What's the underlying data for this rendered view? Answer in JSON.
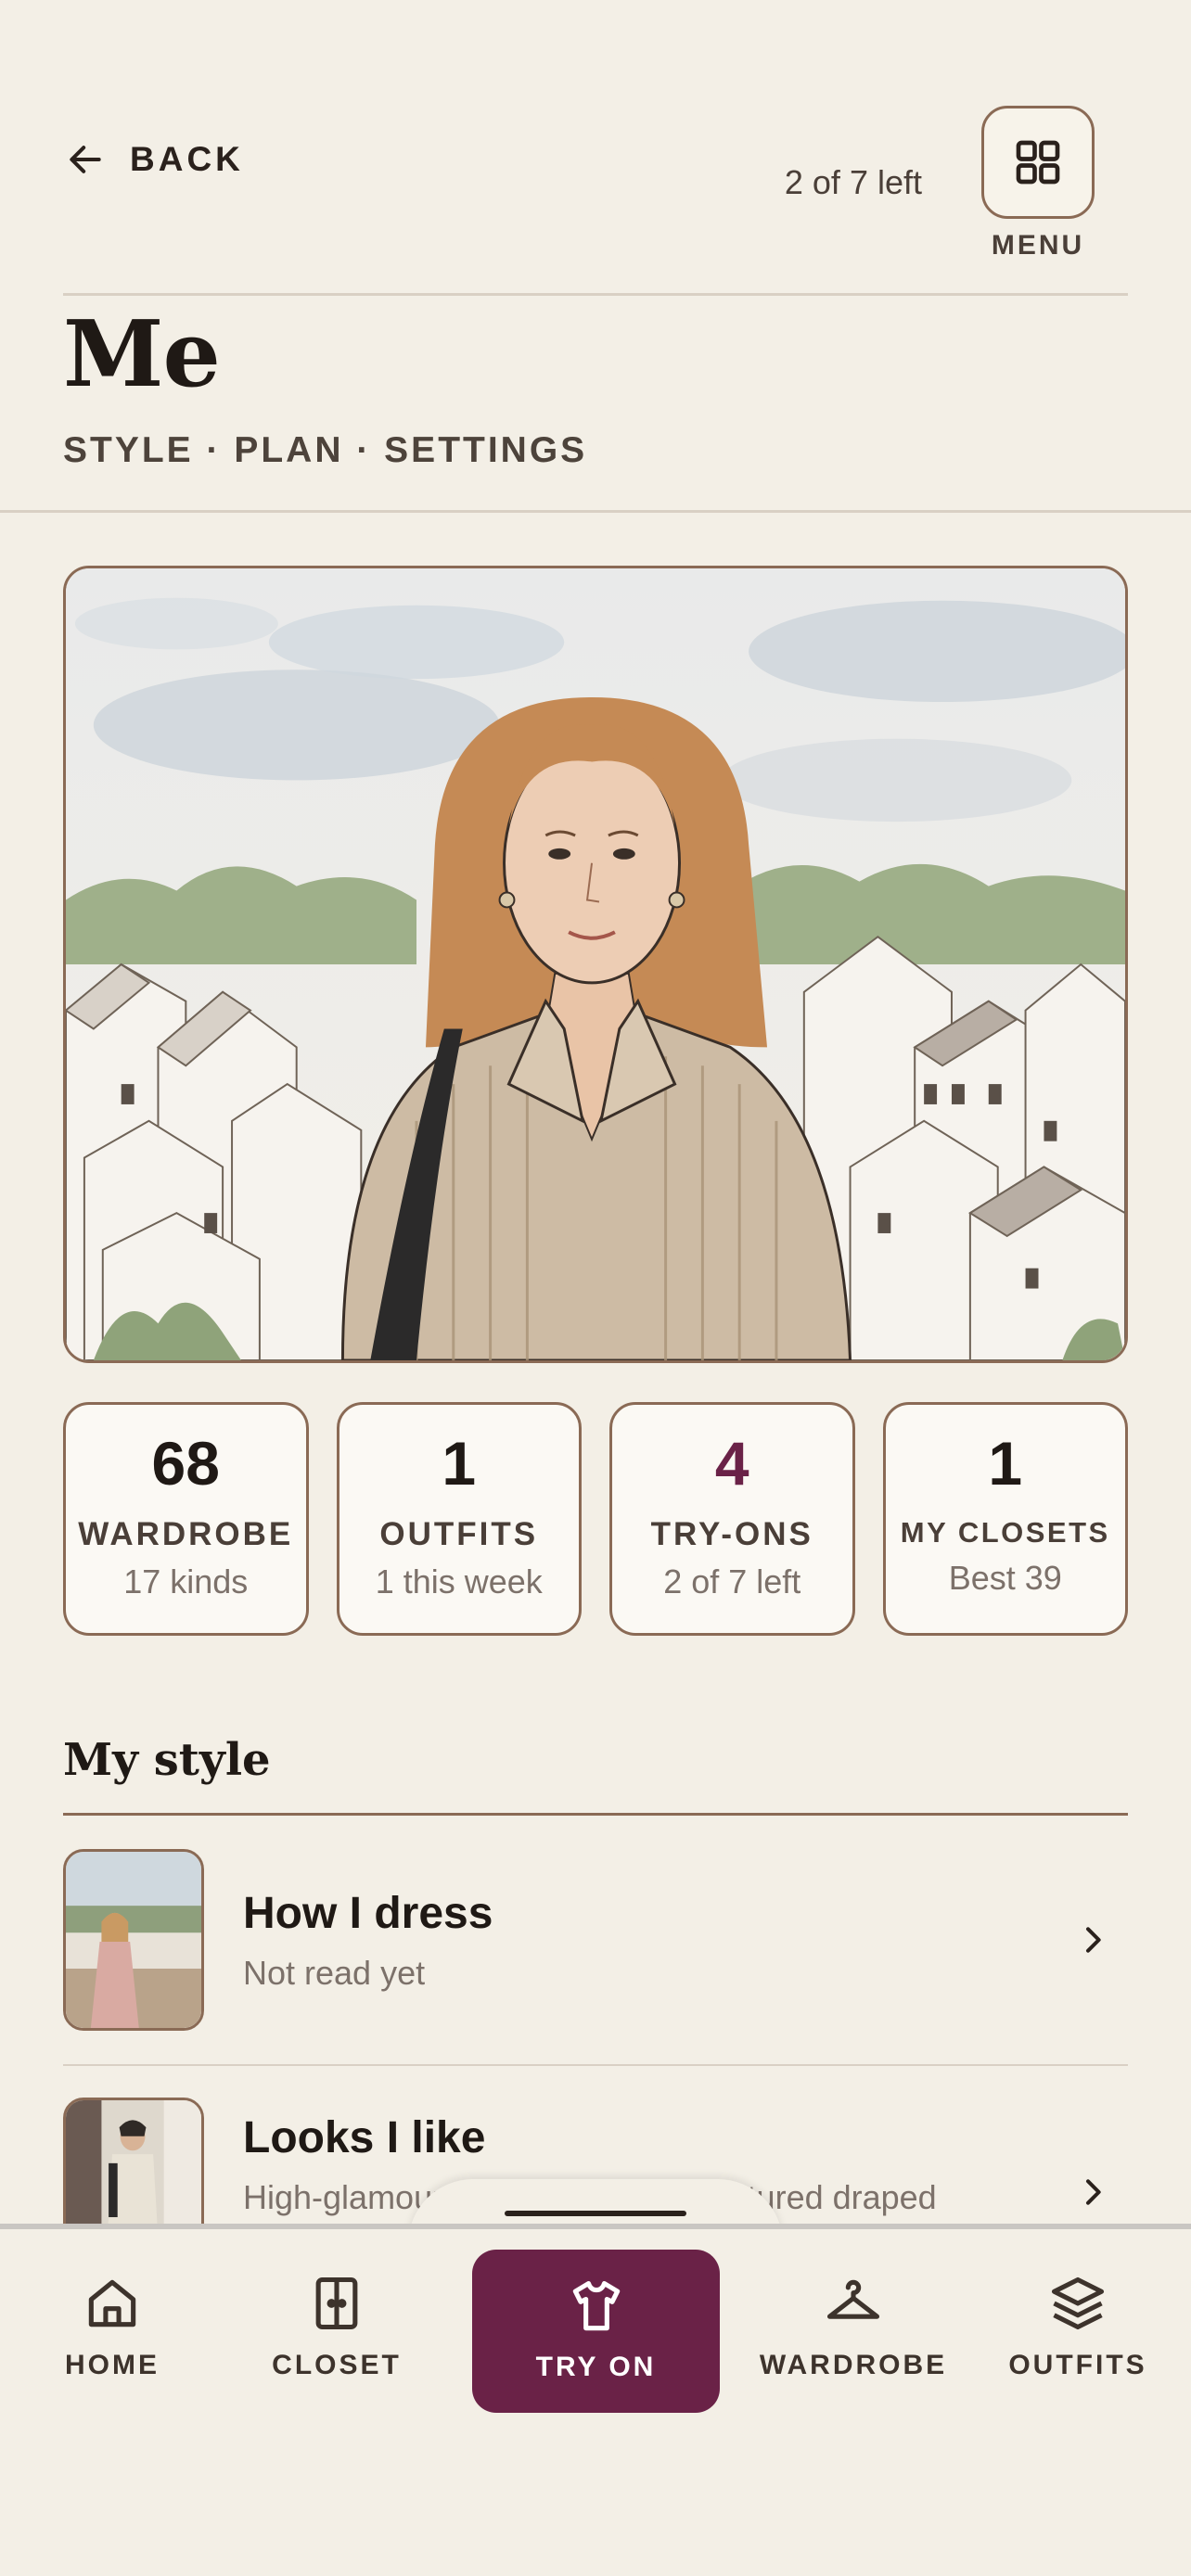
{
  "header": {
    "back_label": "BACK",
    "tries_left": "2 of 7 left",
    "menu_label": "MENU",
    "title": "Me",
    "subnav": "STYLE · PLAN · SETTINGS"
  },
  "stats": [
    {
      "value": "68",
      "label": "WARDROBE",
      "sub": "17 kinds"
    },
    {
      "value": "1",
      "label": "OUTFITS",
      "sub": "1 this week"
    },
    {
      "value": "4",
      "label": "TRY-ONS",
      "sub": "2 of 7 left"
    },
    {
      "value": "1",
      "label": "MY CLOSETS",
      "sub": "Best 39"
    }
  ],
  "my_style": {
    "title": "My style",
    "items": [
      {
        "title": "How I dress",
        "sub": "Not read yet"
      },
      {
        "title": "Looks I like",
        "sub": "High-glamour model-off-duty structured draped"
      }
    ]
  },
  "tabbar": {
    "items": [
      {
        "label": "HOME",
        "icon": "home-icon"
      },
      {
        "label": "CLOSET",
        "icon": "closet-icon"
      },
      {
        "label": "TRY ON",
        "icon": "shirt-icon",
        "active": true
      },
      {
        "label": "WARDROBE",
        "icon": "hanger-icon"
      },
      {
        "label": "OUTFITS",
        "icon": "layers-icon"
      }
    ]
  },
  "colors": {
    "background": "#f3efe6",
    "accent": "#6a2247",
    "border": "#8a6a55",
    "text": "#2a211c"
  }
}
